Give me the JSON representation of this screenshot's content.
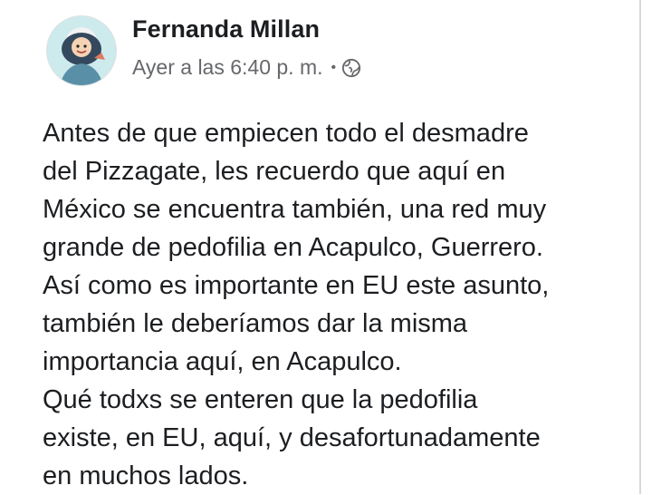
{
  "post": {
    "author": "Fernanda Millan",
    "timestamp": "Ayer a las 6:40 p. m.",
    "separator": "•",
    "privacy_icon": "globe-icon",
    "avatar_icon": "profile-avatar-cartoon",
    "text_lines": [
      "Antes de que empiecen todo el desmadre",
      "del Pizzagate, les recuerdo que aquí en",
      "México se encuentra también, una red muy",
      "grande de pedofilia en Acapulco, Guerrero.",
      "Así como es importante en EU este asunto,",
      "también le deberíamos dar la misma",
      "importancia aquí, en Acapulco.",
      "Qué todxs se enteren que la pedofilia",
      "existe, en EU, aquí, y desafortunadamente",
      "en muchos lados."
    ]
  },
  "colors": {
    "author": "#1c1e21",
    "meta": "#65676b",
    "background": "#ffffff"
  }
}
